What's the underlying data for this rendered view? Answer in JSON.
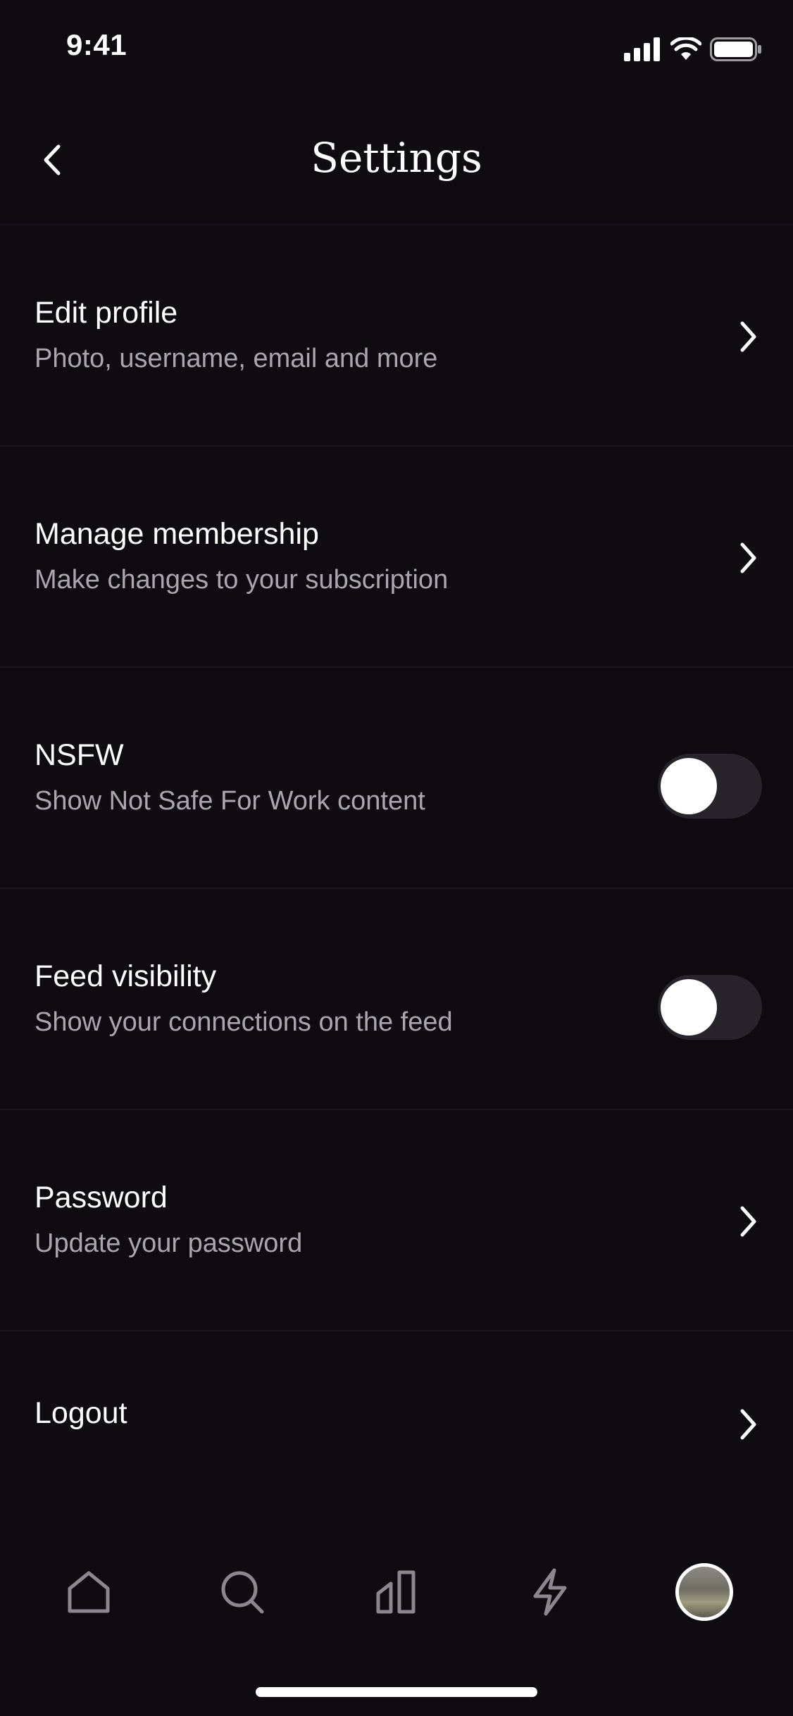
{
  "status_bar": {
    "time": "9:41",
    "icons": [
      "cellular-signal-icon",
      "wifi-icon",
      "battery-icon"
    ]
  },
  "header": {
    "title": "Settings",
    "back_icon": "chevron-left-icon"
  },
  "settings": [
    {
      "title": "Edit profile",
      "subtitle": "Photo, username, email and more",
      "control": "chevron"
    },
    {
      "title": "Manage membership",
      "subtitle": "Make changes to your subscription",
      "control": "chevron"
    },
    {
      "title": "NSFW",
      "subtitle": "Show Not Safe For Work content",
      "control": "toggle",
      "on": false
    },
    {
      "title": "Feed visibility",
      "subtitle": "Show your connections on the feed",
      "control": "toggle",
      "on": false
    },
    {
      "title": "Password",
      "subtitle": "Update your password",
      "control": "chevron"
    },
    {
      "title": "Logout",
      "control": "chevron"
    }
  ],
  "tab_bar": {
    "tabs": [
      "home-icon",
      "search-icon",
      "library-icon",
      "activity-icon",
      "profile-avatar"
    ],
    "selected": "profile-avatar"
  },
  "colors": {
    "background": "#0e0c10",
    "primary_text": "#ffffff",
    "secondary_text": "#a9a7ad",
    "divider": "#1a181d",
    "toggle_track_off": "#27252b"
  }
}
